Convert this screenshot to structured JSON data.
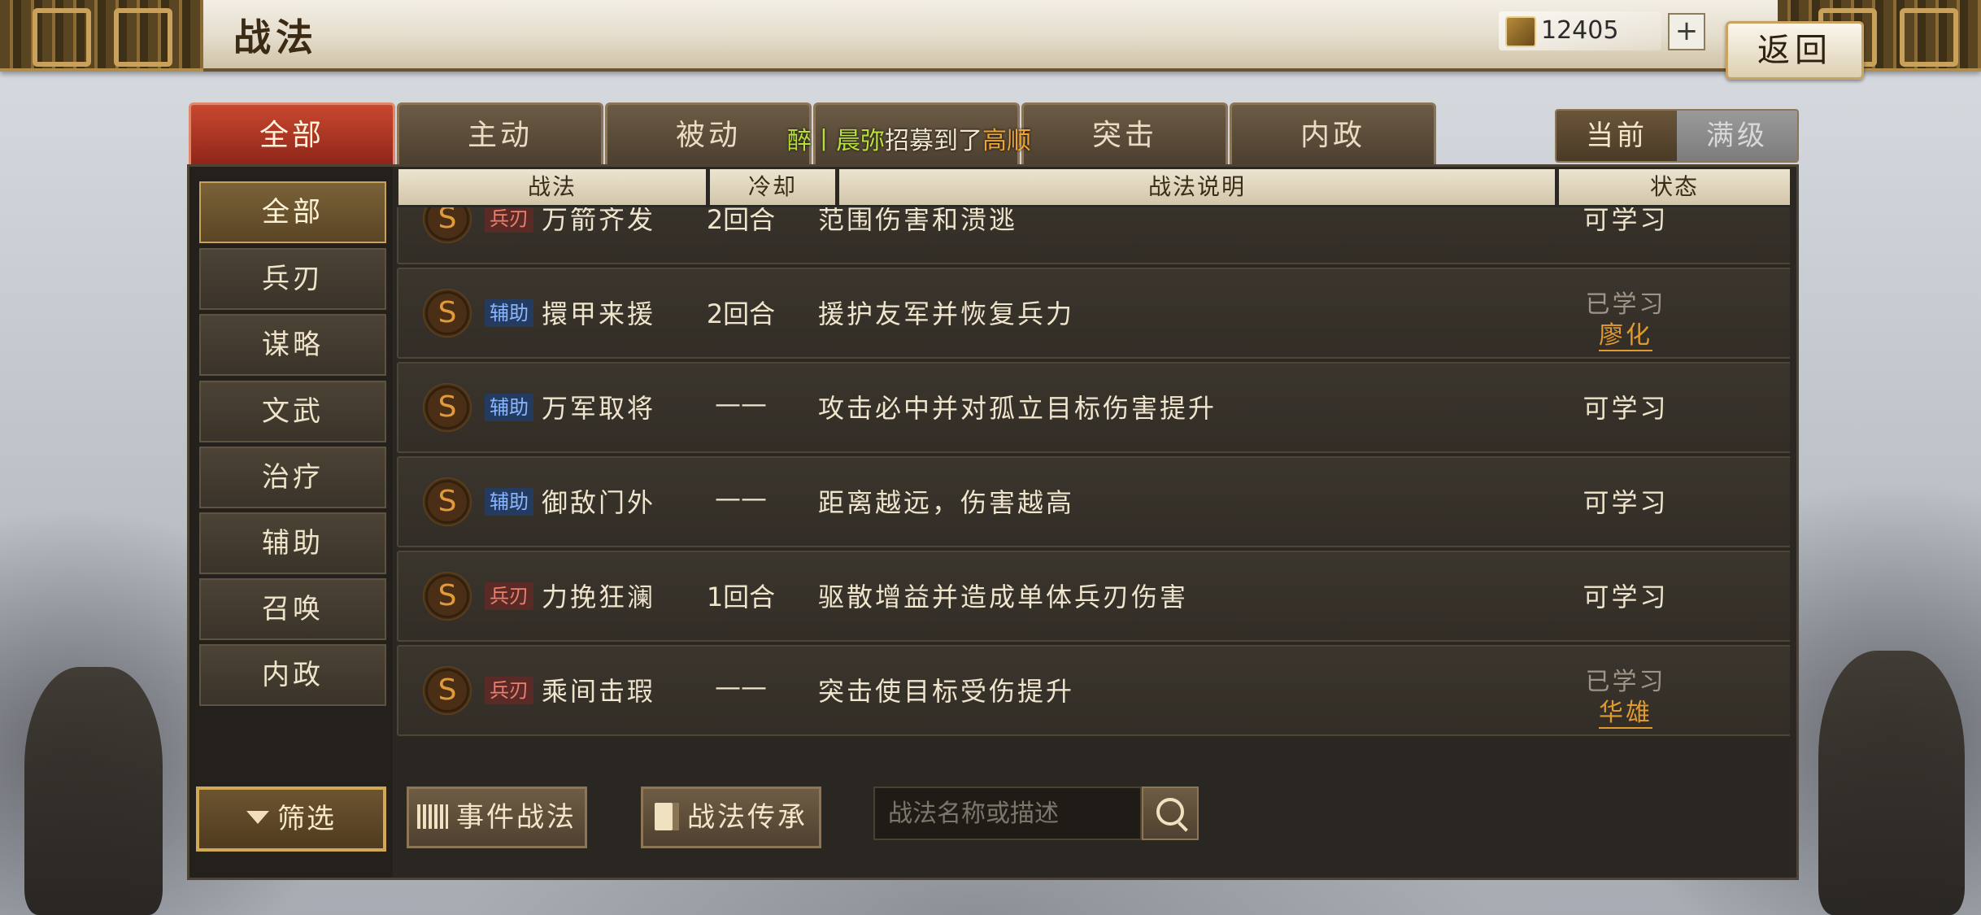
{
  "header": {
    "title": "战法",
    "currency": "12405",
    "plus_label": "+",
    "back_label": "返回"
  },
  "tabs": [
    {
      "label": "全部"
    },
    {
      "label": "主动"
    },
    {
      "label": "被动"
    },
    {
      "label": ""
    },
    {
      "label": "突击"
    },
    {
      "label": "内政"
    }
  ],
  "marquee": {
    "player": "醉丨晨弥",
    "action": "招募到了",
    "general": "高顺"
  },
  "toggle": {
    "current": "当前",
    "max": "满级"
  },
  "sidebar": {
    "items": [
      {
        "label": "全部"
      },
      {
        "label": "兵刃"
      },
      {
        "label": "谋略"
      },
      {
        "label": "文武"
      },
      {
        "label": "治疗"
      },
      {
        "label": "辅助"
      },
      {
        "label": "召唤"
      },
      {
        "label": "内政"
      }
    ]
  },
  "filter_label": "筛选",
  "table": {
    "headers": {
      "name": "战法",
      "cooldown": "冷却",
      "desc": "战法说明",
      "status": "状态"
    },
    "rows": [
      {
        "grade": "S",
        "type": "兵刃",
        "name": "万箭齐发",
        "cooldown": "2回合",
        "desc": "范围伤害和溃逃",
        "status": "可学习",
        "learner": ""
      },
      {
        "grade": "S",
        "type": "辅助",
        "name": "擐甲来援",
        "cooldown": "2回合",
        "desc": "援护友军并恢复兵力",
        "status": "已学习",
        "learner": "廖化"
      },
      {
        "grade": "S",
        "type": "辅助",
        "name": "万军取将",
        "cooldown": "——",
        "desc": "攻击必中并对孤立目标伤害提升",
        "status": "可学习",
        "learner": ""
      },
      {
        "grade": "S",
        "type": "辅助",
        "name": "御敌门外",
        "cooldown": "——",
        "desc": "距离越远，伤害越高",
        "status": "可学习",
        "learner": ""
      },
      {
        "grade": "S",
        "type": "兵刃",
        "name": "力挽狂澜",
        "cooldown": "1回合",
        "desc": "驱散增益并造成单体兵刃伤害",
        "status": "可学习",
        "learner": ""
      },
      {
        "grade": "S",
        "type": "兵刃",
        "name": "乘间击瑕",
        "cooldown": "——",
        "desc": "突击使目标受伤提升",
        "status": "已学习",
        "learner": "华雄"
      }
    ]
  },
  "bottom": {
    "event_label": "事件战法",
    "inherit_label": "战法传承",
    "search_placeholder": "战法名称或描述"
  }
}
